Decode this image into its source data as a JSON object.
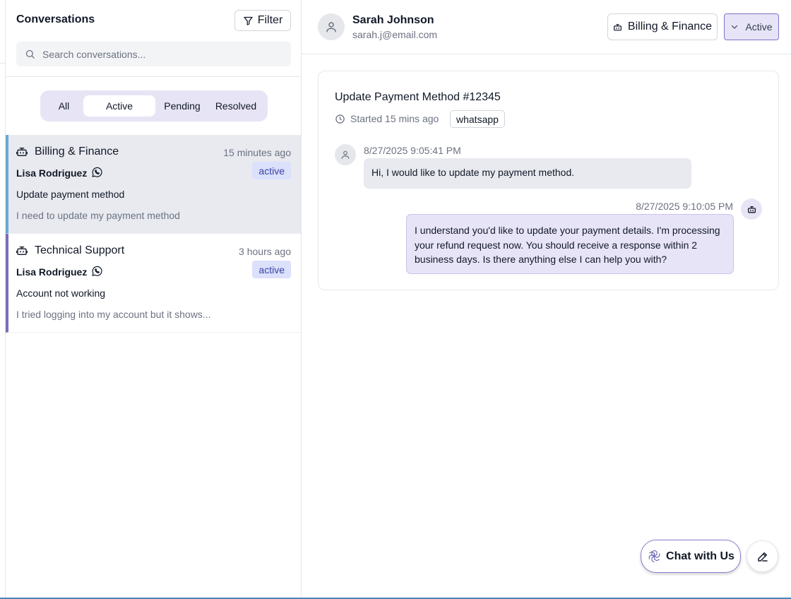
{
  "sidebar": {
    "title": "Conversations",
    "filter_label": "Filter",
    "search_placeholder": "Search conversations...",
    "tabs": [
      {
        "label": "All"
      },
      {
        "label": "Active"
      },
      {
        "label": "Pending"
      },
      {
        "label": "Resolved"
      }
    ],
    "selected_tab": "Active",
    "conversations": [
      {
        "department": "Billing & Finance",
        "time": "15 minutes ago",
        "customer": "Lisa Rodriguez",
        "status": "active",
        "subject": "Update payment method",
        "preview": "I need to update my payment method",
        "selected": true
      },
      {
        "department": "Technical Support",
        "time": "3 hours ago",
        "customer": "Lisa Rodriguez",
        "status": "active",
        "subject": "Account not working",
        "preview": "I tried logging into my account but it shows...",
        "selected": false
      }
    ]
  },
  "header": {
    "customer_name": "Sarah Johnson",
    "customer_email": "sarah.j@email.com",
    "department_label": "Billing & Finance",
    "status_label": "Active"
  },
  "conversation": {
    "title": "Update Payment Method #12345",
    "started": "Started 15 mins ago",
    "channel": "whatsapp",
    "messages": [
      {
        "sender": "customer",
        "timestamp": "8/27/2025 9:05:41 PM",
        "text": "Hi, I would like to update my payment method."
      },
      {
        "sender": "bot",
        "timestamp": "8/27/2025 9:10:05 PM",
        "text": "I understand you'd like to update your payment details. I'm processing your refund request now. You should receive a response within 2 business days. Is there anything else I can help you with?"
      }
    ]
  },
  "widget": {
    "chat_label": "Chat with Us"
  },
  "colors": {
    "accent": "#7f73c9",
    "badge_bg": "#dbe0fb",
    "badge_text": "#3943a6",
    "selected_row_bg": "#e8eaef",
    "selected_row_border": "#6aa7d6",
    "bot_bubble_bg": "#e7e4f7"
  },
  "icons": {
    "filter": "filter-icon",
    "search": "search-icon",
    "bot": "bot-icon",
    "whatsapp": "whatsapp-icon",
    "user": "user-icon",
    "chevron": "chevron-down-icon",
    "clock": "clock-icon",
    "chat": "openai-logo-icon",
    "edit": "pencil-icon"
  }
}
